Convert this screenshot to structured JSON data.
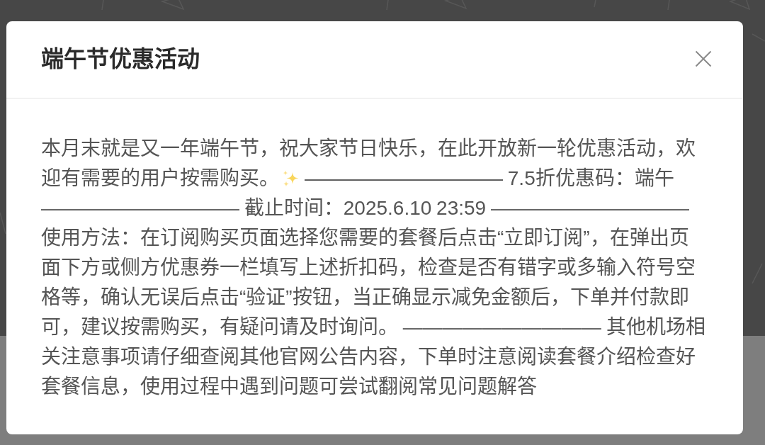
{
  "dialog": {
    "title": "端午节优惠活动",
    "body": [
      {
        "kind": "text",
        "text": "本月末就是又一年端午节，祝大家节日快乐，在此开放新一轮优惠活动，欢迎有需要的用户按需购买。"
      },
      {
        "kind": "icon"
      },
      {
        "kind": "text",
        "text": "—————————— 7.5折优惠码：端午 —————————— 截止时间：2025.6.10 23:59 —————————— 使用方法：在订阅购买页面选择您需要的套餐后点击“立即订阅”，在弹出页面下方或侧方优惠券一栏填写上述折扣码，检查是否有错字或多输入符号空格等，确认无误后点击“验证”按钮，当正确显示减免金额后，下单并付款即可，建议按需购买，有疑问请及时询问。 —————————— 其他机场相关注意事项请仔细查阅其他官网公告内容，下单时注意阅读套餐介绍检查好套餐信息，使用过程中遇到问题可尝试翻阅常见问题解答"
      }
    ]
  }
}
